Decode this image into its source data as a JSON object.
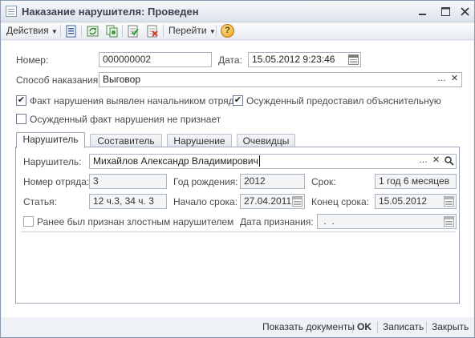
{
  "window": {
    "title": "Наказание нарушителя: Проведен"
  },
  "toolbar": {
    "actions_label": "Действия",
    "goto_label": "Перейти",
    "help_label": "?"
  },
  "header": {
    "number_label": "Номер:",
    "number_value": "000000002",
    "date_label": "Дата:",
    "date_value": "15.05.2012  9:23:46",
    "punishment_label": "Способ наказания:",
    "punishment_value": "Выговор",
    "check1_label": "Факт нарушения выявлен начальником отряда",
    "check1_checked": true,
    "check2_label": "Осужденный предоставил объяснительную",
    "check2_checked": true,
    "check3_label": "Осужденный факт нарушения не признает",
    "check3_checked": false
  },
  "tabs": [
    "Нарушитель",
    "Составитель",
    "Нарушение",
    "Очевидцы"
  ],
  "violator": {
    "violator_label": "Нарушитель:",
    "violator_value": "Михайлов Александр Владимирович",
    "squad_label": "Номер отряда:",
    "squad_value": "3",
    "birth_year_label": "Год рождения:",
    "birth_year_value": "2012",
    "term_label": "Срок:",
    "term_value": "1 год 6 месяцев",
    "article_label": "Статья:",
    "article_value": "12 ч.3, 34 ч. 3",
    "term_start_label": "Начало срока:",
    "term_start_value": "27.04.2011",
    "term_end_label": "Конец срока:",
    "term_end_value": "15.05.2012",
    "malicious_label": "Ранее был признан злостным нарушителем",
    "malicious_checked": false,
    "recognition_date_label": "Дата признания:",
    "recognition_date_value": " .  ."
  },
  "footer": {
    "show_docs": "Показать документы",
    "ok": "OK",
    "save": "Записать",
    "close": "Закрыть"
  }
}
